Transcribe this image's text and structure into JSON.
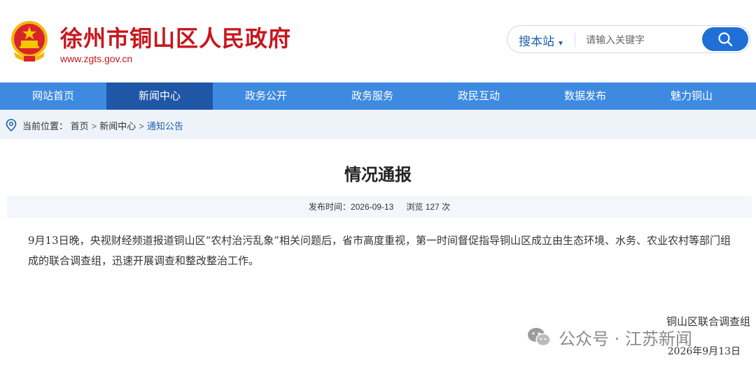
{
  "header": {
    "site_title": "徐州市铜山区人民政府",
    "site_url": "www.zgts.gov.cn",
    "emblem_icon": "national-emblem-icon",
    "brand_color": "#c8161d"
  },
  "search": {
    "scope_label": "搜本站",
    "placeholder": "请输入关键字",
    "button_icon": "search-icon",
    "button_color": "#1f6fd6"
  },
  "nav": {
    "items": [
      {
        "label": "网站首页"
      },
      {
        "label": "新闻中心"
      },
      {
        "label": "政务公开"
      },
      {
        "label": "政务服务"
      },
      {
        "label": "政民互动"
      },
      {
        "label": "数据发布"
      },
      {
        "label": "魅力铜山"
      }
    ],
    "active_index": 1,
    "bg_color": "#3d8ae0",
    "active_color": "#1f56a5"
  },
  "breadcrumb": {
    "prefix": "当前位置：",
    "items": [
      "首页",
      "新闻中心",
      "通知公告"
    ],
    "separator": ">"
  },
  "article": {
    "title": "情况通报",
    "publish_label": "发布时间：",
    "publish_date": "2026-09-13",
    "views_label": "浏览",
    "views_count": "127",
    "views_unit": "次",
    "paragraph": "9月13日晚，央视财经频道报道铜山区“农村治污乱象”相关问题后，省市高度重视，第一时间督促指导铜山区成立由生态环境、水务、农业农村等部门组成的联合调查组，迅速开展调查和整改整治工作。",
    "signature": "铜山区联合调查组",
    "sign_date": "2026年9月13日"
  },
  "watermark": {
    "text": "公众号 · 江苏新闻",
    "icon": "wechat-icon"
  }
}
